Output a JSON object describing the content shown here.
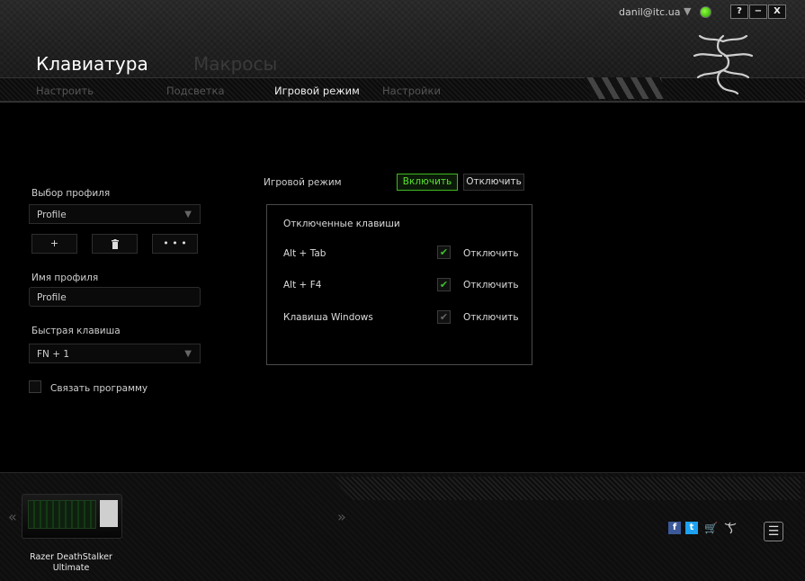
{
  "window": {
    "user_email": "danil@itc.ua",
    "buttons": {
      "help": "?",
      "minimize": "−",
      "close": "X"
    }
  },
  "header": {
    "main_tabs": [
      {
        "label": "Клавиатура",
        "active": true
      },
      {
        "label": "Макросы",
        "active": false
      }
    ],
    "sub_tabs": [
      {
        "label": "Настроить",
        "active": false
      },
      {
        "label": "Подсветка",
        "active": false
      },
      {
        "label": "Игровой режим",
        "active": true
      },
      {
        "label": "Настройки",
        "active": false
      }
    ]
  },
  "profile_panel": {
    "profile_select_label": "Выбор профиля",
    "profile_select_value": "Profile",
    "add_button": "+",
    "delete_button": "🗑",
    "more_button": "• • •",
    "profile_name_label": "Имя профиля",
    "profile_name_value": "Profile",
    "hotkey_label": "Быстрая клавиша",
    "hotkey_value": "FN + 1",
    "link_program_label": "Связать программу"
  },
  "game_mode": {
    "label": "Игровой режим",
    "enable_button": "Включить",
    "disable_button": "Отключить",
    "disabled_keys_title": "Отключенные клавиши",
    "keys": [
      {
        "name": "Alt + Tab",
        "checked": true,
        "action_label": "Отключить"
      },
      {
        "name": "Alt + F4",
        "checked": true,
        "action_label": "Отключить"
      },
      {
        "name": "Клавиша Windows",
        "checked": false,
        "action_label": "Отключить"
      }
    ]
  },
  "footer": {
    "device_name": "Razer DeathStalker Ultimate",
    "prev_arrow": "«",
    "next_arrow": "»",
    "menu_icon": "☰"
  },
  "colors": {
    "accent_green": "#44d62c",
    "background": "#000000"
  }
}
